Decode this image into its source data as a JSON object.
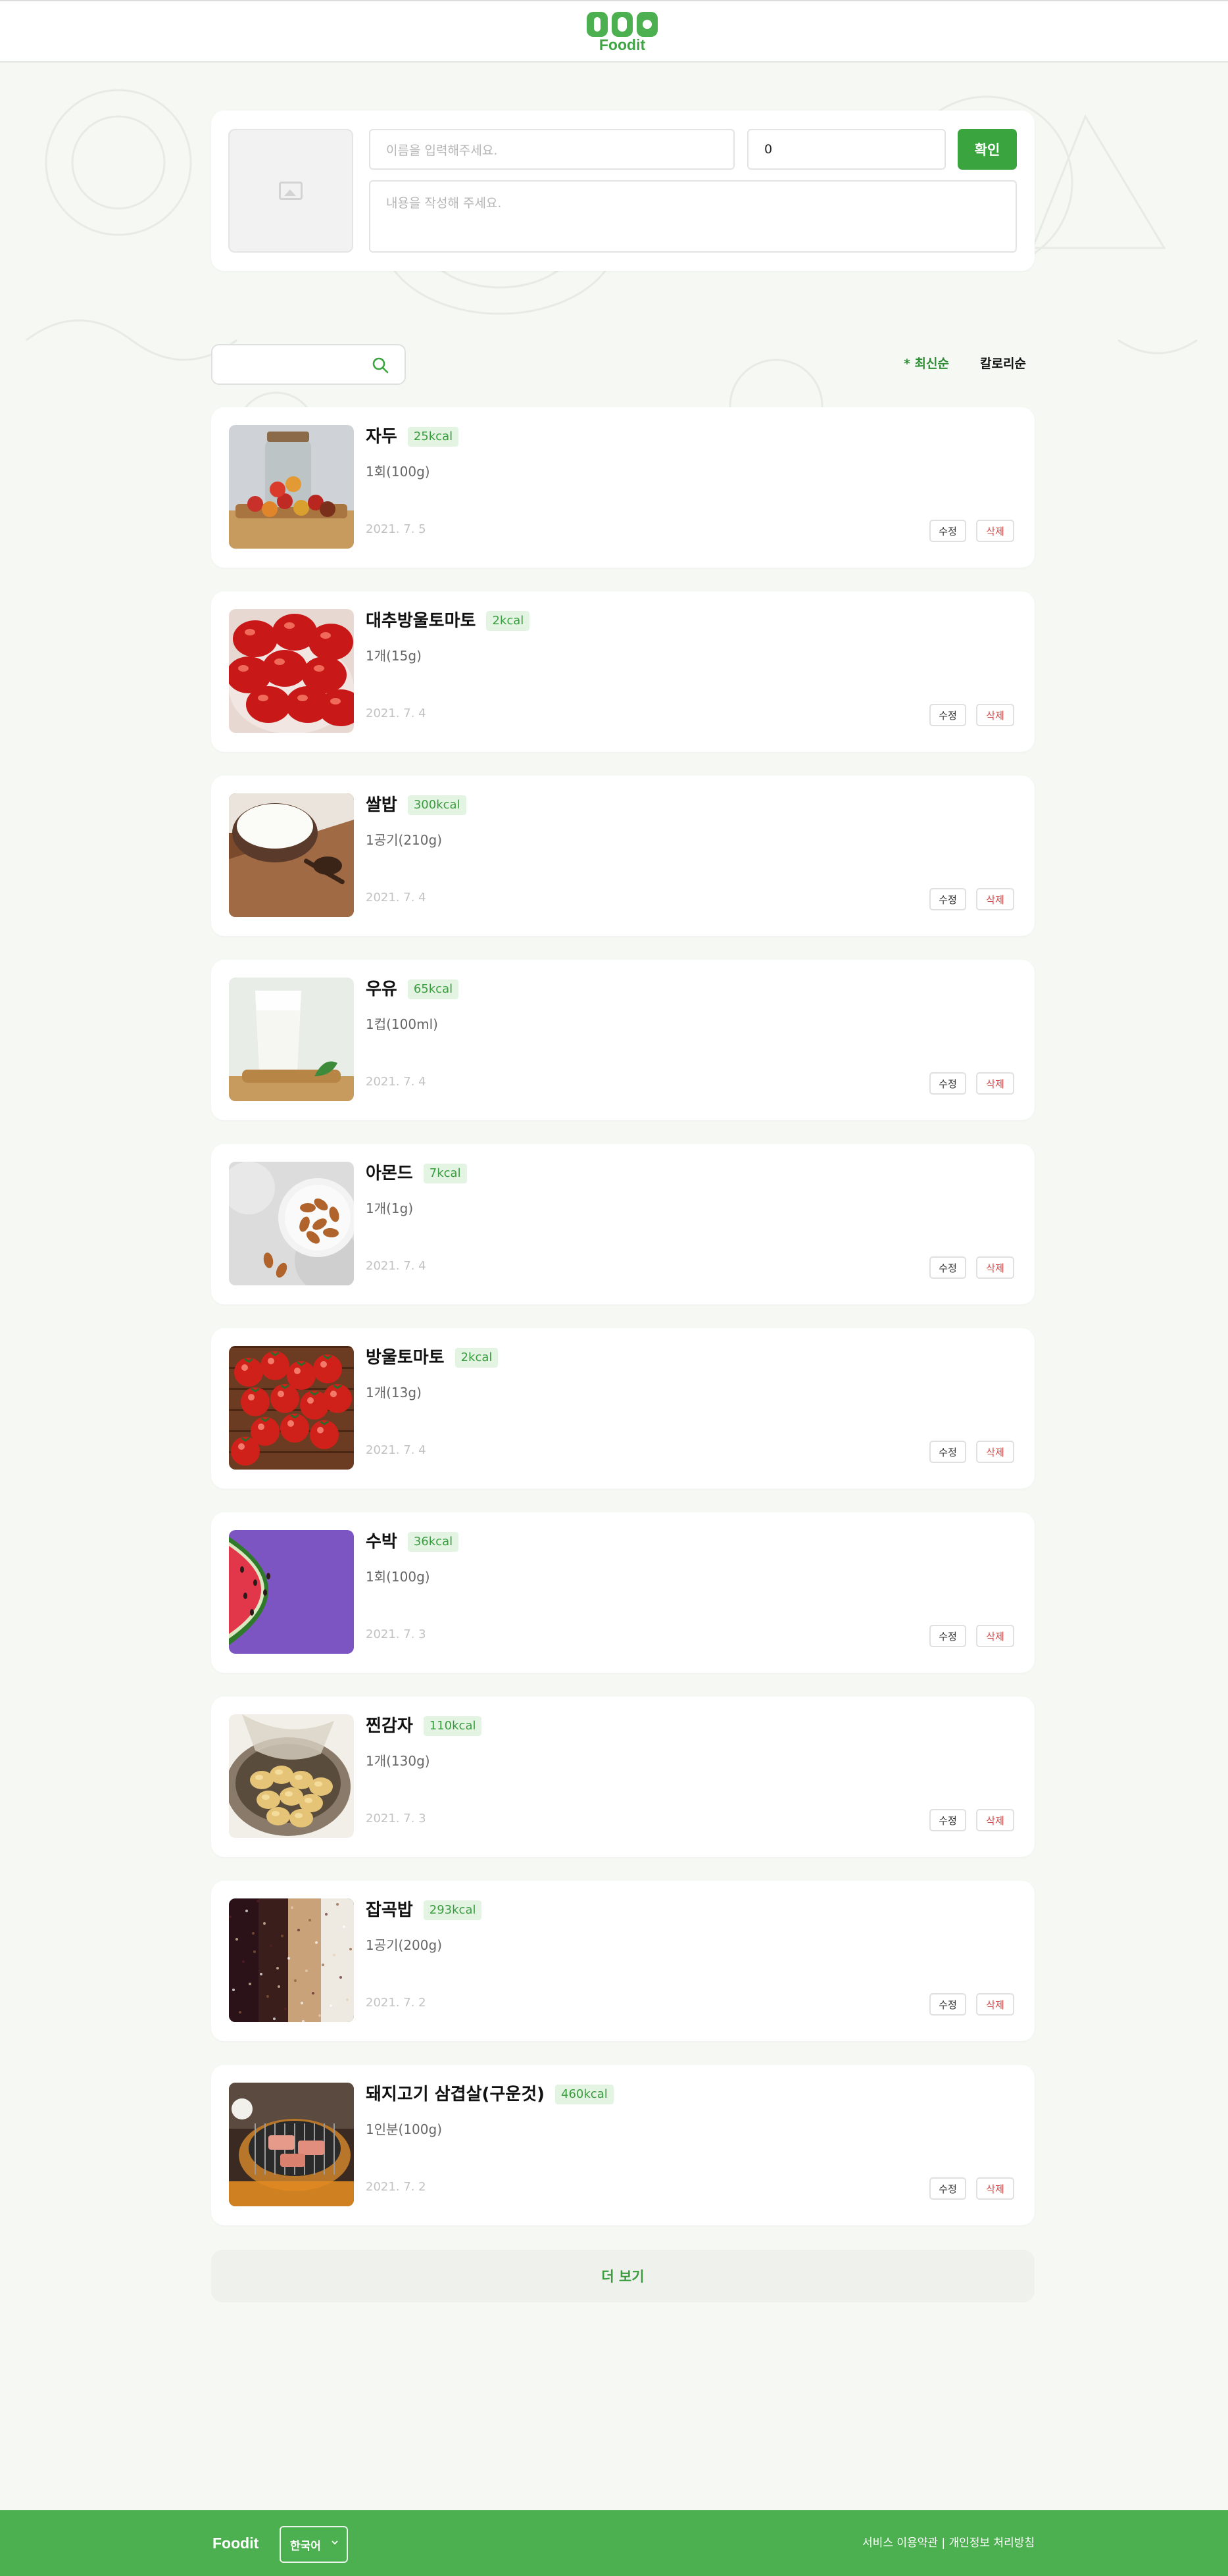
{
  "header": {
    "logo_text": "Foodit"
  },
  "composer": {
    "name_placeholder": "이름을 입력해주세요.",
    "kcal_value": "0",
    "content_placeholder": "내용을 작성해 주세요.",
    "confirm_label": "확인"
  },
  "search": {
    "placeholder": ""
  },
  "sort": {
    "latest_label": "* 최신순",
    "calorie_label": "칼로리순"
  },
  "foods": [
    {
      "name": "자두",
      "kcal": "25kcal",
      "amount": "1회(100g)",
      "date": "2021. 7. 5",
      "image": "plum"
    },
    {
      "name": "대추방울토마토",
      "kcal": "2kcal",
      "amount": "1개(15g)",
      "date": "2021. 7. 4",
      "image": "jujube-tomato"
    },
    {
      "name": "쌀밥",
      "kcal": "300kcal",
      "amount": "1공기(210g)",
      "date": "2021. 7. 4",
      "image": "rice"
    },
    {
      "name": "우유",
      "kcal": "65kcal",
      "amount": "1컵(100ml)",
      "date": "2021. 7. 4",
      "image": "milk"
    },
    {
      "name": "아몬드",
      "kcal": "7kcal",
      "amount": "1개(1g)",
      "date": "2021. 7. 4",
      "image": "almond"
    },
    {
      "name": "방울토마토",
      "kcal": "2kcal",
      "amount": "1개(13g)",
      "date": "2021. 7. 4",
      "image": "cherry-tomato"
    },
    {
      "name": "수박",
      "kcal": "36kcal",
      "amount": "1회(100g)",
      "date": "2021. 7. 3",
      "image": "watermelon"
    },
    {
      "name": "찐감자",
      "kcal": "110kcal",
      "amount": "1개(130g)",
      "date": "2021. 7. 3",
      "image": "potato"
    },
    {
      "name": "잡곡밥",
      "kcal": "293kcal",
      "amount": "1공기(200g)",
      "date": "2021. 7. 2",
      "image": "multigrain"
    },
    {
      "name": "돼지고기 삼겹살(구운것)",
      "kcal": "460kcal",
      "amount": "1인분(100g)",
      "date": "2021. 7. 2",
      "image": "pork-belly"
    }
  ],
  "card_actions": {
    "edit_label": "수정",
    "delete_label": "삭제"
  },
  "load_more_label": "더 보기",
  "footer": {
    "brand": "Foodit",
    "language": "한국어",
    "links": "서비스 이용약관 | 개인정보 처리방침"
  },
  "colors": {
    "brand_green": "#4caf50",
    "accent_green": "#3aa43e",
    "badge_bg": "#e3f4e3",
    "delete_red": "#d34848",
    "page_bg": "#f5f8f3"
  }
}
